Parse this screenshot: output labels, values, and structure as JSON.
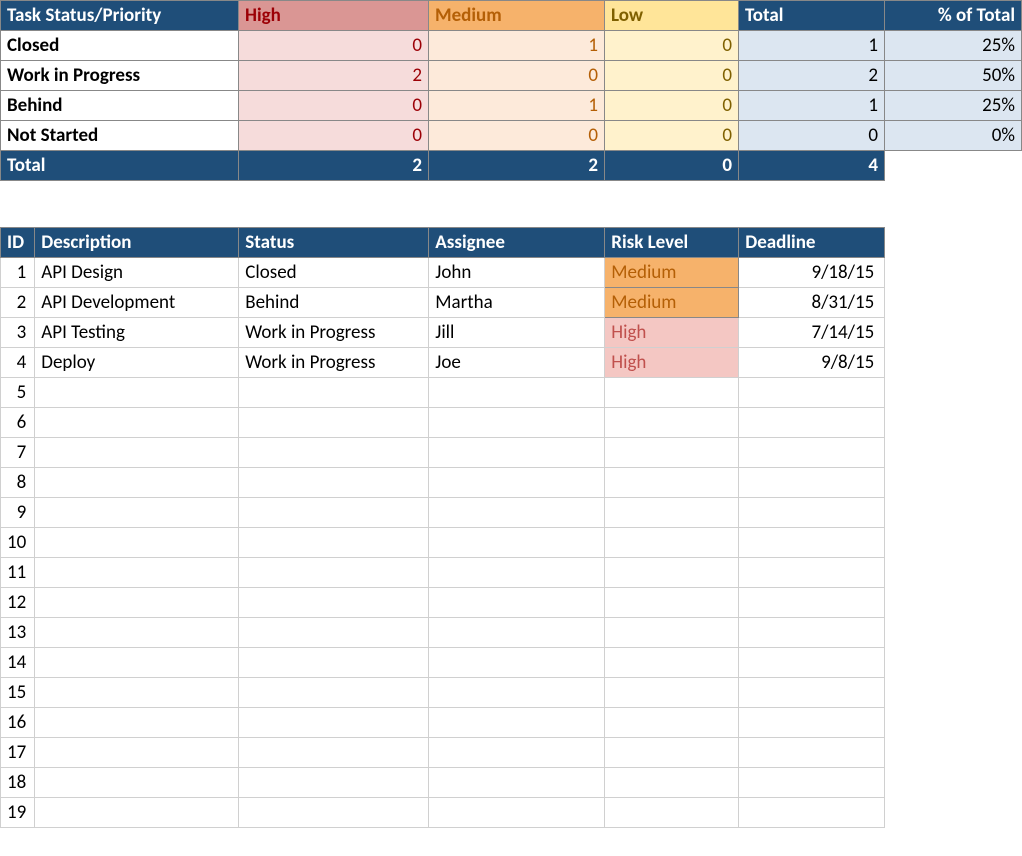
{
  "summary": {
    "cornerLabel": "Task Status/Priority",
    "priorities": [
      "High",
      "Medium",
      "Low"
    ],
    "totalLabel": "Total",
    "pctLabel": "% of Total",
    "rows": [
      {
        "label": "Closed",
        "high": 0,
        "med": 1,
        "low": 0,
        "total": 1,
        "pct": "25%"
      },
      {
        "label": "Work in Progress",
        "high": 2,
        "med": 0,
        "low": 0,
        "total": 2,
        "pct": "50%"
      },
      {
        "label": "Behind",
        "high": 0,
        "med": 1,
        "low": 0,
        "total": 1,
        "pct": "25%"
      },
      {
        "label": "Not Started",
        "high": 0,
        "med": 0,
        "low": 0,
        "total": 0,
        "pct": "0%"
      }
    ],
    "totals": {
      "label": "Total",
      "high": 2,
      "med": 2,
      "low": 0,
      "total": 4
    }
  },
  "tasks": {
    "headers": {
      "id": "ID",
      "description": "Description",
      "status": "Status",
      "assignee": "Assignee",
      "risk": "Risk Level",
      "deadline": "Deadline"
    },
    "rows": [
      {
        "id": 1,
        "description": "API Design",
        "status": "Closed",
        "assignee": "John",
        "risk": "Medium",
        "deadline": "9/18/15"
      },
      {
        "id": 2,
        "description": "API Development",
        "status": "Behind",
        "assignee": "Martha",
        "risk": "Medium",
        "deadline": "8/31/15"
      },
      {
        "id": 3,
        "description": "API Testing",
        "status": "Work in Progress",
        "assignee": "Jill",
        "risk": "High",
        "deadline": "7/14/15"
      },
      {
        "id": 4,
        "description": "Deploy",
        "status": "Work in Progress",
        "assignee": "Joe",
        "risk": "High",
        "deadline": "9/8/15"
      }
    ],
    "emptyRowStart": 5,
    "emptyRowEnd": 19
  }
}
